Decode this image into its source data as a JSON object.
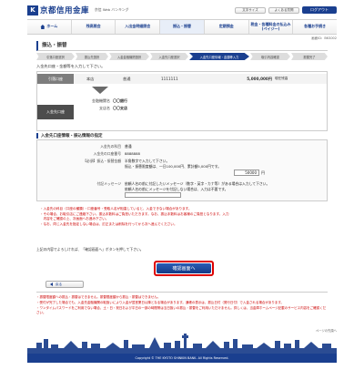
{
  "header": {
    "logo_mark": "K",
    "logo_text": "京都信用金庫",
    "logo_sub": "京信 Web バンキング",
    "btn_font": "文字サイズ",
    "btn_faq": "よくある質問",
    "logout": "ログアウト"
  },
  "nav": {
    "items": [
      {
        "label": "ホーム"
      },
      {
        "label": "残高照会"
      },
      {
        "label": "入出金明細照会"
      },
      {
        "label": "振込・振替"
      },
      {
        "label": "定期預金"
      },
      {
        "label": "税金・各種料金の払込み (ペイジー)"
      },
      {
        "label": "各種お手続き"
      }
    ]
  },
  "screen_id": "画面ID：BKS002",
  "page_title": "振込・振替",
  "steps": [
    {
      "label": "引落口座選択"
    },
    {
      "label": "振込先選択"
    },
    {
      "label": "入金金融機関選択"
    },
    {
      "label": "入金先口座選択"
    },
    {
      "label": "入金先口座情報・金額等入力"
    },
    {
      "label": "取引内容確認"
    },
    {
      "label": "振替完了"
    }
  ],
  "instruction": "入金先口座・金額等を入力して下さい。",
  "transfer": {
    "from_label": "引落口座",
    "from_branch": "本店",
    "from_type": "普通",
    "from_number": "1111111",
    "from_balance": "5,000,000円",
    "from_note": "現在残高",
    "to_label": "入金先口座",
    "bank_key": "金融機関名",
    "bank_val": "〇〇銀行",
    "branch_key": "支店名",
    "branch_val": "〇〇支店"
  },
  "detail": {
    "title": "入金先口座情報・振込情報の指定",
    "type_key": "入金先の科目",
    "type_val": "普通",
    "acct_key": "入金先の口座番号",
    "acct_val": "8888888",
    "amount_key": "【必須】振込・振替金額",
    "amount_note1": "半角数字で入力して下さい。",
    "amount_note2": "振込・振替限度額は、一日100,000円、累計額5,000円です。",
    "amount_val": "50000",
    "amount_unit": "円",
    "memo_key": "付記メッセージ",
    "memo_note1": "依頼人名の前に付記したいメッセージ（数字・英字・カナ等）がある場合は入力して下さい。",
    "memo_note2": "依頼人名の前にメッセージを付記しない場合は、入力は不要です。"
  },
  "notes": [
    "・入金先の科目（口座の種類）・口座番号・受取人名が相違していると、入金できない場合があります。",
    "・その場合、お取引店にご連絡下さい。振込手数料はご負担いただきます。なお、振込手数料はお客様のご負担となります。入力",
    "　内容をご確認の上、次画面へお進み下さい。",
    "・なお、同じ入金先を指定しない場合は、訂正または削除を行ってから次へ進んでください。"
  ],
  "confirm_text": "上記の内容でよろしければ、「確認画面へ」ボタンを押して下さい。",
  "confirm_btn": "確認画面へ",
  "back_btn": "戻る",
  "bottom_notes": [
    "・振替限度額への振込・振替はできません。振替限度額から振込・振替はできません。",
    "・受付が完了した場合でも、入金先金融機関の取扱いにより入金が翌営業日以降となる場合があります。通帳の表示は、振込日付（発行日付）で入金される場合があります。",
    "・ワンタイムパスワードをご利用でない場合、土・日・祝日および平日の一部の時間帯は当日扱いの振込・振替をご利用いただけません。詳しくは、当金庫ホームページ記載のサービス内容をご確認ください。"
  ],
  "pagetop": "ページの先頭へ",
  "footer": "Copyright © THE KYOTO SHINKIN BANK. All Rights Reserved.",
  "colors": {
    "brand": "#1a3f8f",
    "alert": "#cc0000"
  }
}
